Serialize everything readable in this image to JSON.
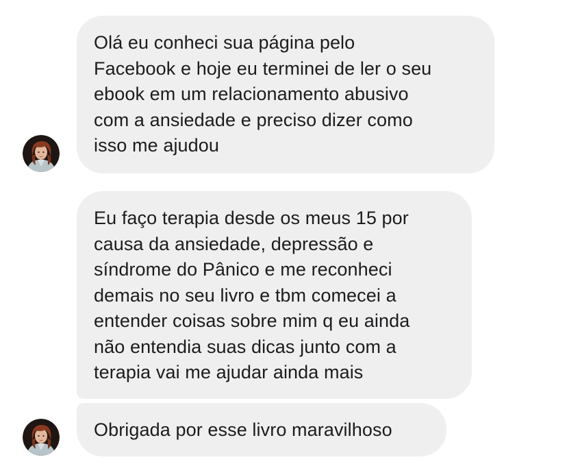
{
  "conversation": {
    "messages": [
      {
        "lines": [
          "Olá eu conheci sua página pelo",
          "Facebook e hoje eu terminei de ler o seu",
          "ebook em um relacionamento abusivo",
          "com a ansiedade e preciso dizer como",
          "isso me ajudou"
        ]
      },
      {
        "lines": [
          "Eu faço terapia desde os meus 15 por",
          "causa da ansiedade, depressão e",
          "síndrome do Pânico e me reconheci",
          "demais no seu livro e tbm comecei a",
          "entender coisas sobre mim q eu ainda",
          "não entendia suas dicas junto com a",
          "terapia vai me ajudar ainda mais"
        ]
      },
      {
        "lines": [
          "Obrigada por esse livro maravilhoso"
        ]
      }
    ]
  },
  "colors": {
    "bubble_background": "#efeff0",
    "text": "#1c1c1e",
    "page_background": "#ffffff"
  },
  "icons": {
    "avatar": "sender-profile-photo"
  }
}
